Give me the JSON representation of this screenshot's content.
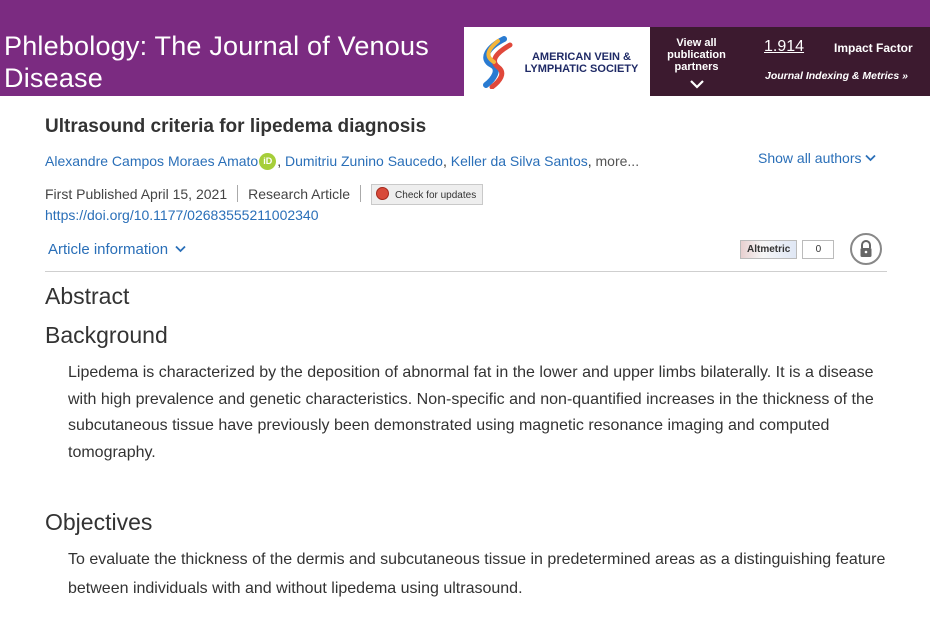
{
  "header": {
    "journal_title": "Phlebology: The Journal of Venous Disease",
    "society_name": "AMERICAN VEIN & LYMPHATIC SOCIETY",
    "partners_label": "View all publication partners",
    "impact_value": "1.914",
    "impact_label": "Impact Factor",
    "indexing_link": "Journal Indexing & Metrics »"
  },
  "article": {
    "title": "Ultrasound criteria for lipedema diagnosis",
    "authors": [
      "Alexandre Campos Moraes Amato",
      "Dumitriu Zunino Saucedo",
      "Keller da Silva Santos"
    ],
    "orcid_label": "iD",
    "more_label": "more...",
    "show_all_authors": "Show all authors",
    "published": "First Published April 15, 2021",
    "type": "Research Article",
    "check_updates": "Check for updates",
    "doi": "https://doi.org/10.1177/02683555211002340",
    "article_info": "Article information",
    "altmetric_label": "Altmetric",
    "altmetric_count": "0"
  },
  "abstract": {
    "heading": "Abstract",
    "background_heading": "Background",
    "background_text": "Lipedema is characterized by the deposition of abnormal fat in the lower and upper limbs bilaterally. It is a disease with high prevalence and genetic characteristics. Non-specific and non-quantified increases in the thickness of the subcutaneous tissue have previously been demonstrated using magnetic resonance imaging and computed tomography.",
    "objectives_heading": "Objectives",
    "objectives_text": "To evaluate the thickness of the dermis and subcutaneous tissue in predetermined areas as a distinguishing feature between individuals with and without lipedema using ultrasound."
  },
  "colors": {
    "header_purple": "#7b2b81",
    "header_dark": "#3c1a2f",
    "link_blue": "#2a6fb8",
    "orcid_green": "#a6ce39"
  },
  "icons": [
    "society-logo-icon",
    "chevron-down-icon",
    "orcid-icon",
    "check-updates-icon",
    "lock-icon"
  ]
}
